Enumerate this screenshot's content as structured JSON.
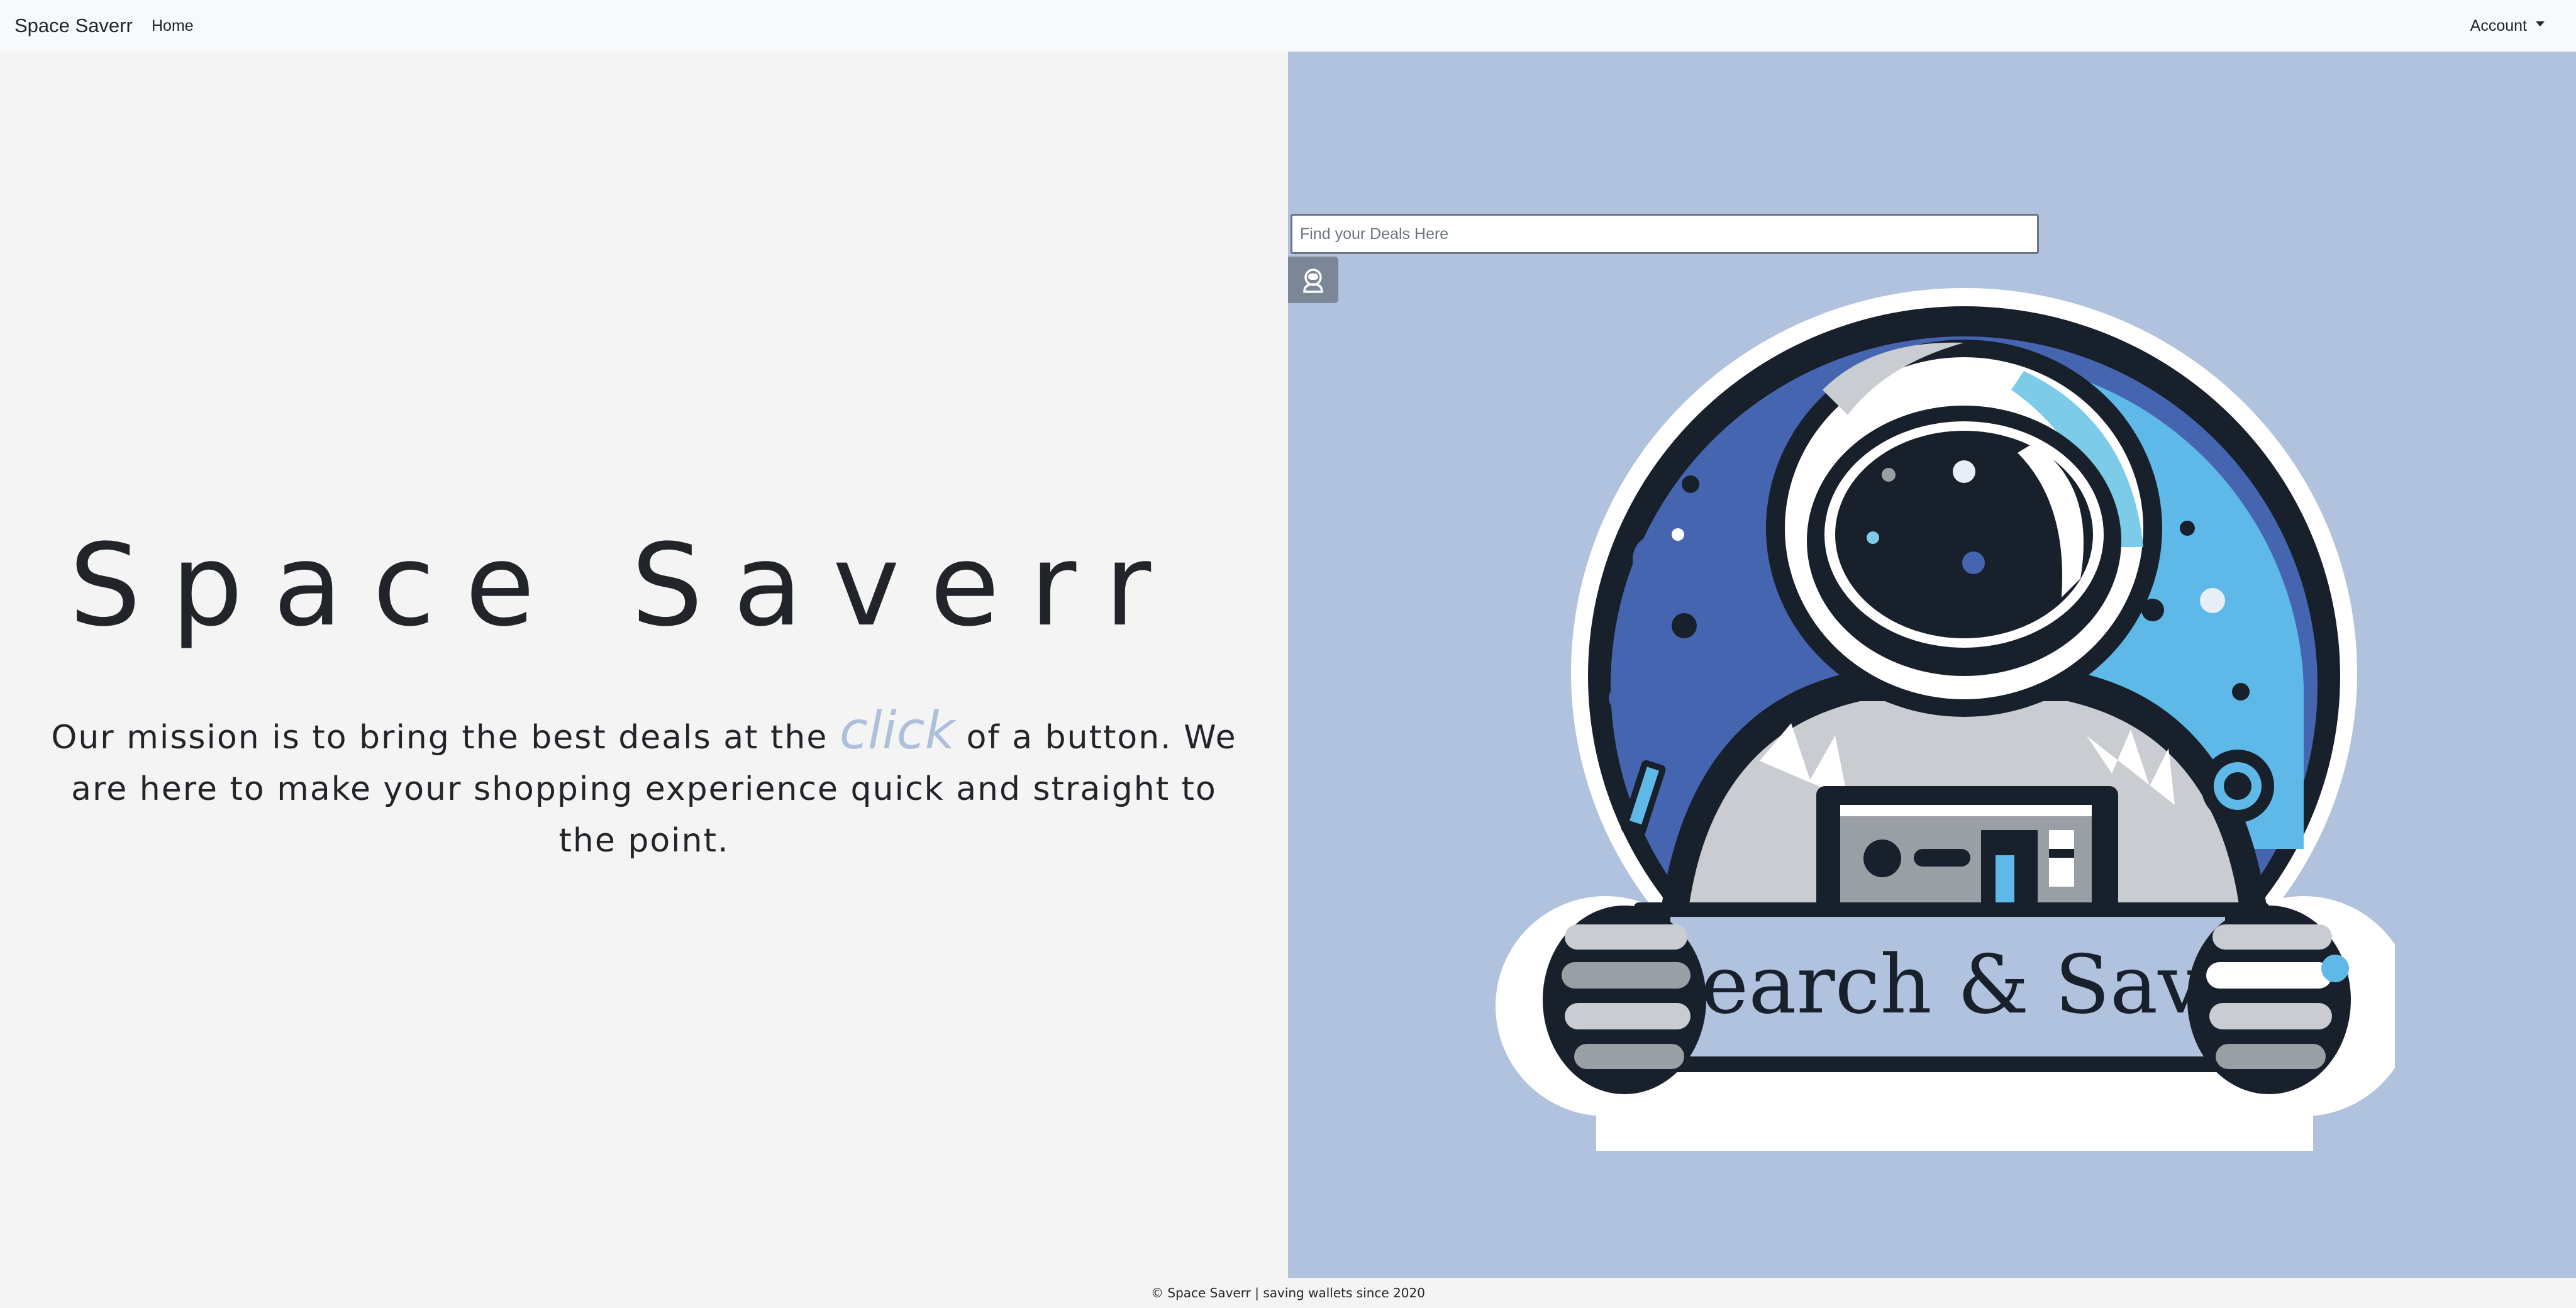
{
  "navbar": {
    "brand": "Space Saverr",
    "home": "Home",
    "account": "Account"
  },
  "hero": {
    "title": "Space Saverr",
    "mission_before": "Our mission is to bring the best deals at the ",
    "mission_emphasis": "click",
    "mission_after": " of a button. We are here to make your shopping experience quick and straight to the point."
  },
  "search": {
    "placeholder": "Find your Deals Here",
    "button_icon": "astronaut-icon"
  },
  "mascot": {
    "sign_text": "Search & Save",
    "icon": "astronaut-mascot"
  },
  "footer": {
    "text": "© Space Saverr | saving wallets since 2020"
  },
  "colors": {
    "navbar_bg": "#f8f9fa",
    "left_bg": "#f4f4f4",
    "right_bg": "#b0c2dd",
    "accent_click": "#aebfdb",
    "search_button_bg": "#7b8797",
    "mascot_dark": "#17202b",
    "mascot_blue": "#5fb9e8",
    "mascot_royal": "#4565b0"
  }
}
